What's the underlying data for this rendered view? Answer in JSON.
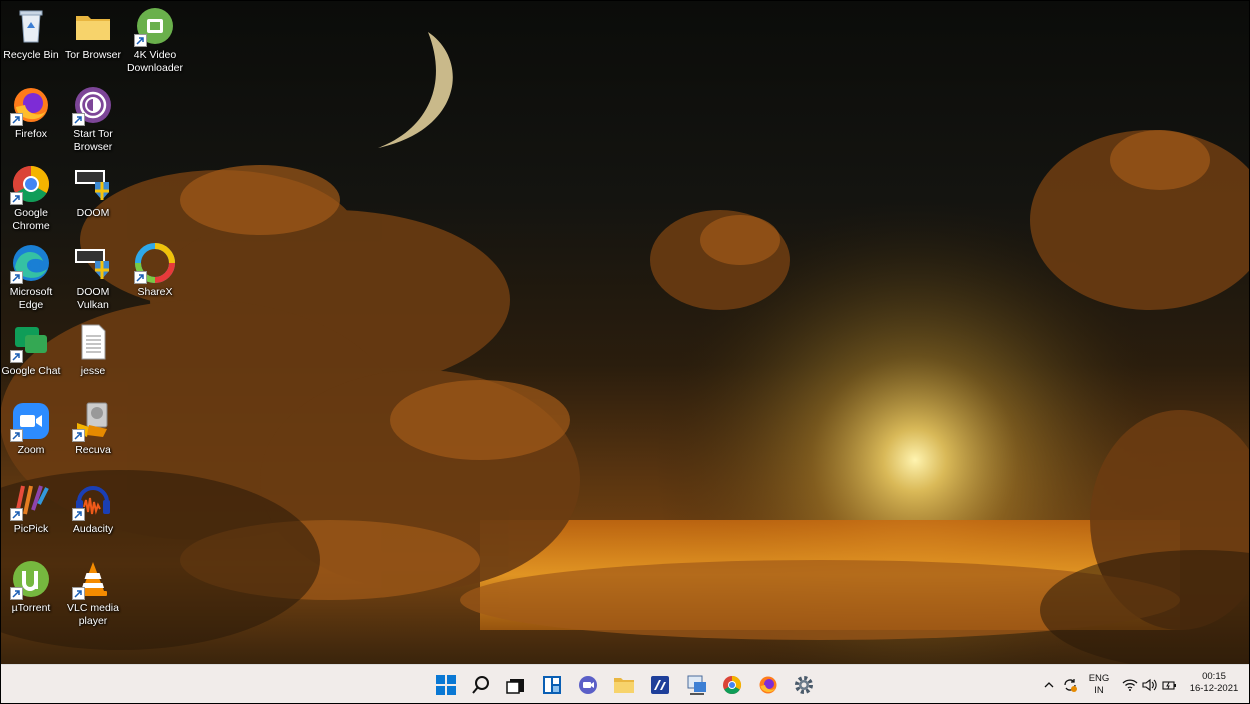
{
  "desktop": {
    "icons": [
      {
        "id": "recycle-bin",
        "label": "Recycle Bin"
      },
      {
        "id": "tor-browser-folder",
        "label": "Tor Browser"
      },
      {
        "id": "4k-video-downloader",
        "label": "4K Video Downloader"
      },
      {
        "id": "firefox",
        "label": "Firefox"
      },
      {
        "id": "start-tor-browser",
        "label": "Start Tor Browser"
      },
      {
        "id": "google-chrome",
        "label": "Google Chrome"
      },
      {
        "id": "doom",
        "label": "DOOM"
      },
      {
        "id": "microsoft-edge",
        "label": "Microsoft Edge"
      },
      {
        "id": "doom-vulkan",
        "label": "DOOM Vulkan"
      },
      {
        "id": "sharex",
        "label": "ShareX"
      },
      {
        "id": "google-chat",
        "label": "Google Chat"
      },
      {
        "id": "jesse",
        "label": "jesse"
      },
      {
        "id": "zoom",
        "label": "Zoom"
      },
      {
        "id": "recuva",
        "label": "Recuva"
      },
      {
        "id": "picpick",
        "label": "PicPick"
      },
      {
        "id": "audacity",
        "label": "Audacity"
      },
      {
        "id": "utorrent",
        "label": "µTorrent"
      },
      {
        "id": "vlc-media-player",
        "label": "VLC media player"
      }
    ]
  },
  "taskbar": {
    "tray": {
      "language": "ENG",
      "region": "IN",
      "time": "00:15",
      "date": "16-12-2021"
    }
  }
}
